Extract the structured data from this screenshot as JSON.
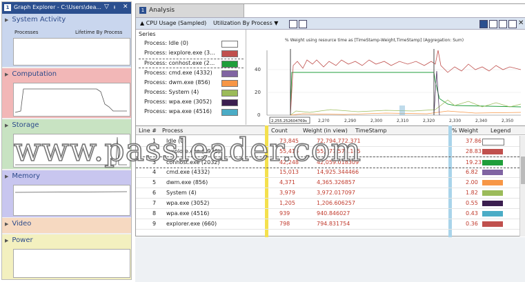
{
  "graph_explorer": {
    "number": "1",
    "title": "Graph Explorer - C:\\Users\\dea...",
    "controls": [
      "▽",
      "ᵼ",
      "✕"
    ],
    "sections": [
      {
        "name": "System Activity",
        "col1": "Processes",
        "col2": "Lifetime By Process",
        "color": "#c9d6ee"
      },
      {
        "name": "Computation",
        "color": "#f2b7b7"
      },
      {
        "name": "Storage",
        "color": "#c8e3c2"
      },
      {
        "name": "Memory",
        "color": "#c8c6ef"
      },
      {
        "name": "Video",
        "color": "#f6d9c1"
      },
      {
        "name": "Power",
        "color": "#f3f0bf"
      }
    ]
  },
  "analysis": {
    "tab_number": "1",
    "tab_label": "Analysis",
    "toolbar": {
      "graph_label": "▲ CPU Usage (Sampled)",
      "preset_label": "Utilization By Process ▼"
    },
    "series_label": "Series",
    "series": [
      {
        "name": "Process: Idle (0)",
        "color": "#ffffff"
      },
      {
        "name": "Process: iexplore.exe (3...",
        "color": "#c0504d"
      },
      {
        "name": "Process: conhost.exe (2...",
        "color": "#1f9e3a"
      },
      {
        "name": "Process: cmd.exe (4332)",
        "color": "#8064a2"
      },
      {
        "name": "Process: dwm.exe (856)",
        "color": "#f79646"
      },
      {
        "name": "Process: System (4)",
        "color": "#9bbb59"
      },
      {
        "name": "Process: wpa.exe (3052)",
        "color": "#3b1e4f"
      },
      {
        "name": "Process: wpa.exe (4516)",
        "color": "#4bacc6"
      }
    ],
    "chart": {
      "title": "% Weight using resource time as [TimeStamp-Weight,TimeStamp] (Aggregation: Sum)",
      "y_ticks": [
        "40",
        "20",
        "0"
      ],
      "x_ticks": [
        "2,255.252604769s",
        "2,2?0",
        "2,290",
        "2,300",
        "2,310",
        "2,320",
        "2,330",
        "2,340",
        "2,350"
      ]
    },
    "columns": [
      "Line #",
      "Process",
      "Count",
      "Weight (in view)",
      "TimeStamp",
      "% Weight",
      "Legend"
    ],
    "rows": [
      {
        "line": "1",
        "process": "Idle (0)",
        "count": "73,845",
        "weight": "72,794,772.371",
        "pct": "37.86",
        "color": "#ffffff"
      },
      {
        "line": "2",
        "process": "iexplore.exe (3936)",
        "count": "55,416",
        "weight": "55,277,578.145",
        "pct": "28.83",
        "color": "#c0504d"
      },
      {
        "line": "3",
        "process": "conhost.exe (2032)",
        "count": "42,248",
        "weight": "42,059.018309",
        "pct": "19.23",
        "color": "#1f9e3a"
      },
      {
        "line": "4",
        "process": "cmd.exe (4332)",
        "count": "15,013",
        "weight": "14,925.344466",
        "pct": "6.82",
        "color": "#8064a2"
      },
      {
        "line": "5",
        "process": "dwm.exe (856)",
        "count": "4,371",
        "weight": "4,365.326857",
        "pct": "2.00",
        "color": "#f79646"
      },
      {
        "line": "6",
        "process": "System (4)",
        "count": "3,979",
        "weight": "3,972.017097",
        "pct": "1.82",
        "color": "#9bbb59"
      },
      {
        "line": "7",
        "process": "wpa.exe (3052)",
        "count": "1,205",
        "weight": "1,206.606257",
        "pct": "0.55",
        "color": "#3b1e4f"
      },
      {
        "line": "8",
        "process": "wpa.exe (4516)",
        "count": "939",
        "weight": "940.846027",
        "pct": "0.43",
        "color": "#4bacc6"
      },
      {
        "line": "9",
        "process": "explorer.exe (660)",
        "count": "798",
        "weight": "794.831754",
        "pct": "0.36",
        "color": "#c0504d"
      }
    ]
  },
  "watermark": "www.passleader.com"
}
